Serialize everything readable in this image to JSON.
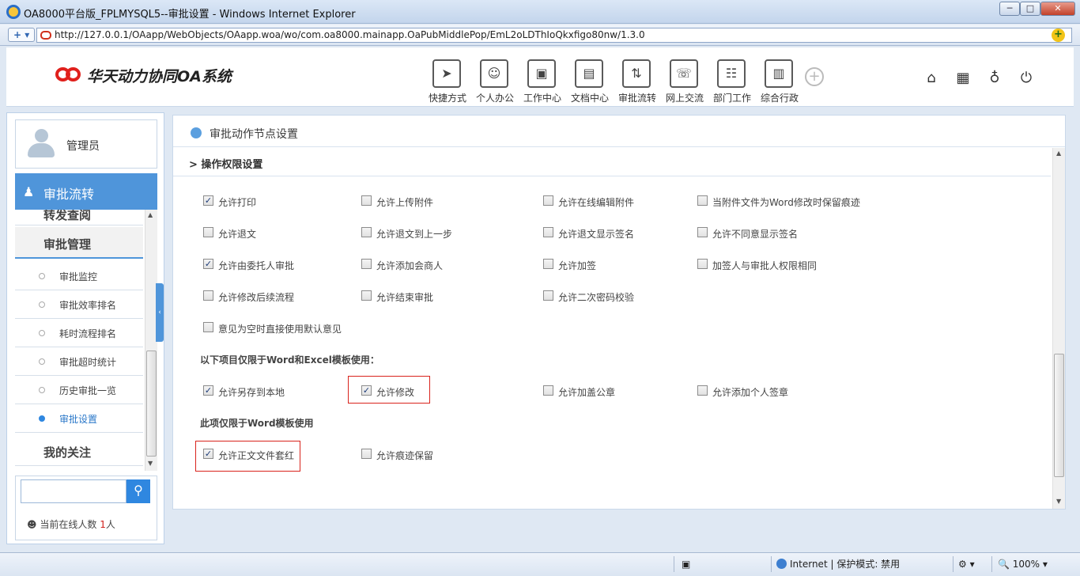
{
  "window": {
    "title": "OA8000平台版_FPLMYSQL5--审批设置 - Windows Internet Explorer",
    "minimize": "─",
    "maximize": "□",
    "close": "✕"
  },
  "address_bar": {
    "url": "http://127.0.0.1/OAapp/WebObjects/OAapp.woa/wo/com.oa8000.mainapp.OaPubMiddlePop/EmL2oLDThIoQkxfigo80nw/1.3.0",
    "nav_label": "+ ▾",
    "go_glyph": "+"
  },
  "app": {
    "name": "华天动力协同OA系统"
  },
  "top_nav": [
    {
      "label": "快捷方式",
      "icon": "paper-plane-icon",
      "glyph": "➤"
    },
    {
      "label": "个人办公",
      "icon": "person-icon",
      "glyph": "☺"
    },
    {
      "label": "工作中心",
      "icon": "briefcase-icon",
      "glyph": "▣"
    },
    {
      "label": "文档中心",
      "icon": "inbox-icon",
      "glyph": "▤"
    },
    {
      "label": "审批流转",
      "icon": "flow-arrows-icon",
      "glyph": "⇅"
    },
    {
      "label": "网上交流",
      "icon": "chat-icon",
      "glyph": "☏"
    },
    {
      "label": "部门工作",
      "icon": "department-icon",
      "glyph": "☷"
    },
    {
      "label": "综合行政",
      "icon": "building-icon",
      "glyph": "▥"
    }
  ],
  "top_nav_add": "+",
  "right_icons": [
    {
      "name": "home-icon",
      "glyph": "⌂"
    },
    {
      "name": "grid-icon",
      "glyph": "▦"
    },
    {
      "name": "shirt-icon",
      "glyph": "♁"
    },
    {
      "name": "power-icon",
      "glyph": "⏻"
    }
  ],
  "sidebar": {
    "user": "管理员",
    "section": "审批流转",
    "section_icon": "♟",
    "cut_item": "转发查阅",
    "group": "审批管理",
    "items": [
      {
        "label": "审批监控",
        "active": false
      },
      {
        "label": "审批效率排名",
        "active": false
      },
      {
        "label": "耗时流程排名",
        "active": false
      },
      {
        "label": "审批超时统计",
        "active": false
      },
      {
        "label": "历史审批一览",
        "active": false
      },
      {
        "label": "审批设置",
        "active": true
      }
    ],
    "after_item": "我的关注",
    "search_placeholder": "",
    "search_glyph": "⚲",
    "online_label": "当前在线人数",
    "online_count": "1",
    "online_unit": "人",
    "online_icon": "☻",
    "collapse_glyph": "‹",
    "scroll_up": "▲",
    "scroll_down": "▼",
    "scroll_grip": "≡"
  },
  "content": {
    "title": "审批动作节点设置",
    "section": "> 操作权限设置",
    "rows": [
      [
        {
          "label": "允许打印",
          "checked": true
        },
        {
          "label": "允许上传附件",
          "checked": false
        },
        {
          "label": "允许在线编辑附件",
          "checked": false
        },
        {
          "label": "当附件文件为Word修改时保留痕迹",
          "checked": false
        }
      ],
      [
        {
          "label": "允许退文",
          "checked": false
        },
        {
          "label": "允许退文到上一步",
          "checked": false
        },
        {
          "label": "允许退文显示签名",
          "checked": false
        },
        {
          "label": "允许不同意显示签名",
          "checked": false
        }
      ],
      [
        {
          "label": "允许由委托人审批",
          "checked": true
        },
        {
          "label": "允许添加会商人",
          "checked": false
        },
        {
          "label": "允许加签",
          "checked": false
        },
        {
          "label": "加签人与审批人权限相同",
          "checked": false
        }
      ],
      [
        {
          "label": "允许修改后续流程",
          "checked": false
        },
        {
          "label": "允许结束审批",
          "checked": false
        },
        {
          "label": "允许二次密码校验",
          "checked": false
        }
      ],
      [
        {
          "label": "意见为空时直接使用默认意见",
          "checked": false
        }
      ]
    ],
    "note_word_excel": "以下项目仅限于Word和Excel模板使用：",
    "word_excel_rows": [
      [
        {
          "label": "允许另存到本地",
          "checked": true
        },
        {
          "label": "允许修改",
          "checked": true,
          "highlight": true
        },
        {
          "label": "允许加盖公章",
          "checked": false
        },
        {
          "label": "允许添加个人签章",
          "checked": false
        }
      ]
    ],
    "note_word": "此项仅限于Word模板使用",
    "word_rows": [
      [
        {
          "label": "允许正文文件套红",
          "checked": true,
          "highlight": true
        },
        {
          "label": "允许痕迹保留",
          "checked": false
        }
      ]
    ],
    "scroll_up": "▲",
    "scroll_down": "▼",
    "scroll_grip": "≡",
    "highlight_color": "#d9231c",
    "check_glyph": "✓"
  },
  "status_bar": {
    "zone": "Internet | 保护模式: 禁用",
    "zoom": "100%",
    "dropdown": "▾"
  },
  "colors": {
    "accent": "#4f95da",
    "brand_red": "#e0201c"
  }
}
